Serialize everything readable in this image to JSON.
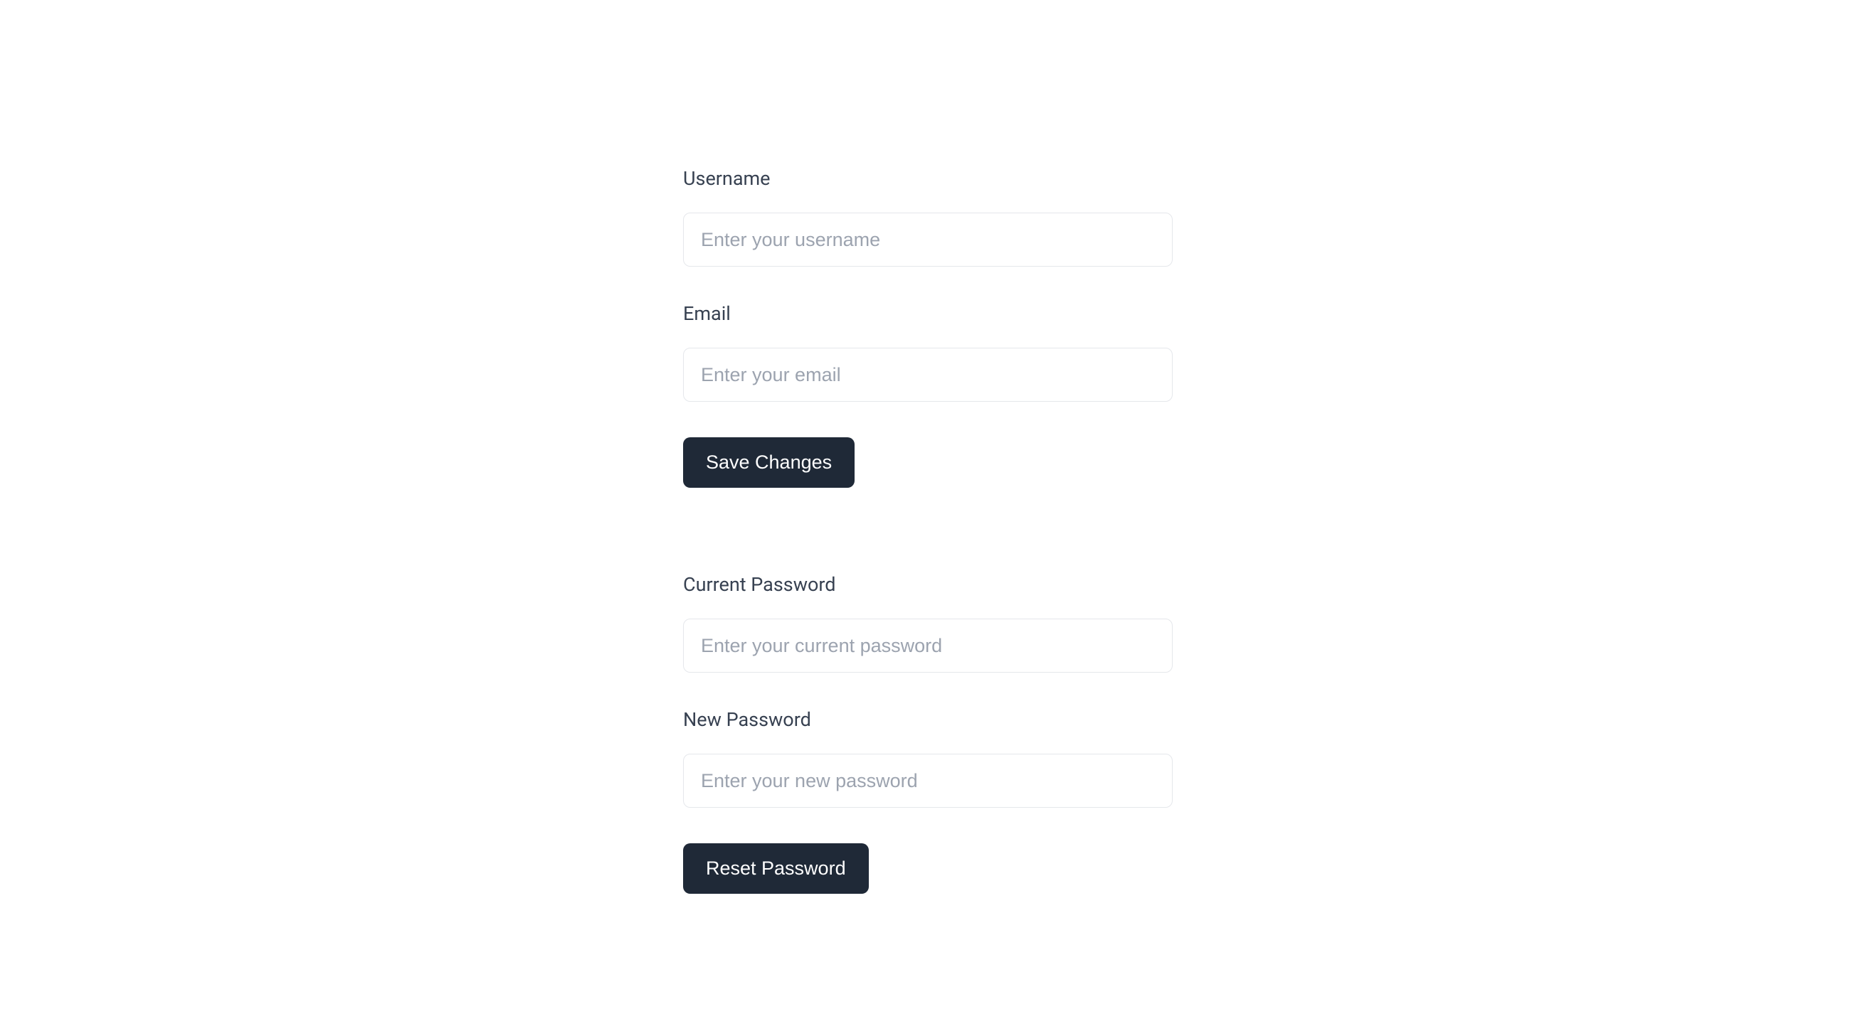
{
  "profile": {
    "username": {
      "label": "Username",
      "placeholder": "Enter your username",
      "value": ""
    },
    "email": {
      "label": "Email",
      "placeholder": "Enter your email",
      "value": ""
    },
    "save_button": "Save Changes"
  },
  "password": {
    "current": {
      "label": "Current Password",
      "placeholder": "Enter your current password",
      "value": ""
    },
    "new": {
      "label": "New Password",
      "placeholder": "Enter your new password",
      "value": ""
    },
    "reset_button": "Reset Password"
  }
}
